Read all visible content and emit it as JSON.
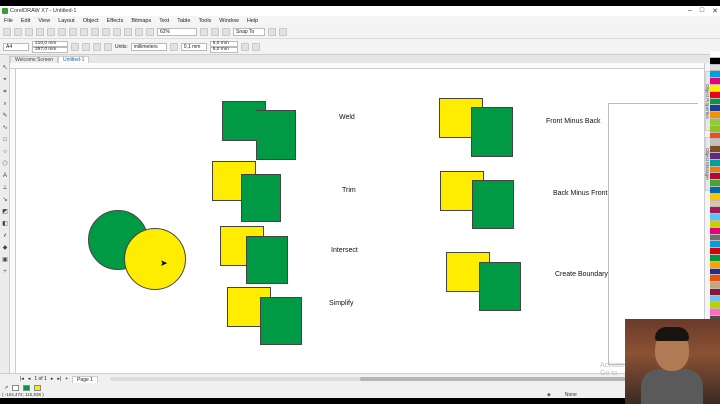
{
  "window": {
    "title": "CorelDRAW X7 - Untitled-1",
    "controls": [
      "–",
      "□",
      "✕"
    ]
  },
  "menu": [
    "File",
    "Edit",
    "View",
    "Layout",
    "Object",
    "Effects",
    "Bitmaps",
    "Text",
    "Table",
    "Tools",
    "Window",
    "Help"
  ],
  "toolbar1": {
    "zoom": "62%",
    "snap": "Snap To"
  },
  "toolbar2": {
    "page_size": "A4",
    "width": "210,0 mm",
    "height": "297,0 mm",
    "units_label": "Units:",
    "units": "millimeters",
    "nudge": "0,1 mm",
    "dup_x": "5,0 mm",
    "dup_y": "5,0 mm"
  },
  "tabs": [
    {
      "label": "Welcome Screen",
      "active": false
    },
    {
      "label": "Untitled-1",
      "active": true
    }
  ],
  "canvas": {
    "labels": {
      "weld": "Weld",
      "trim": "Trim",
      "intersect": "Intersect",
      "simplify": "Simplify",
      "front_minus_back": "Front Minus Back",
      "back_minus_front": "Back Minus Front",
      "create_boundary": "Create Boundary"
    }
  },
  "dockers": [
    "Object Properties",
    "Object Manager"
  ],
  "page_nav": {
    "position": "1 of 1",
    "page": "Page 1"
  },
  "status": {
    "coords": "( -104,472; 115,838 )",
    "fill_none": "None"
  },
  "watermark": {
    "line1": "Activate",
    "line2": "Go to"
  },
  "colors": {
    "green": "#009a44",
    "yellow": "#ffed00",
    "palette": [
      "#ffffff",
      "#000000",
      "#e0e0e0",
      "#00a0e0",
      "#e6007e",
      "#ffed00",
      "#e30613",
      "#009a44",
      "#1d3c8f",
      "#f39200",
      "#8fcb3f",
      "#95c11f",
      "#e94e1b",
      "#c0c0c0",
      "#7d4e24",
      "#662483",
      "#00a19a",
      "#ef7d00",
      "#b30838",
      "#3aaa35",
      "#0069b4",
      "#fdc300",
      "#d9c8a0",
      "#a3195b",
      "#5bc5f2",
      "#c6d300",
      "#e5007d",
      "#6f6f6e",
      "#009fe3",
      "#d70000",
      "#00963f",
      "#f7a600",
      "#312783",
      "#e84e0f",
      "#c4a77e",
      "#8a1538",
      "#6ec4e8",
      "#b9d100",
      "#ff6eb4",
      "#4d4d4d",
      "#f29fc5",
      "#00b1eb",
      "#95d5f1",
      "#ffd200"
    ]
  }
}
